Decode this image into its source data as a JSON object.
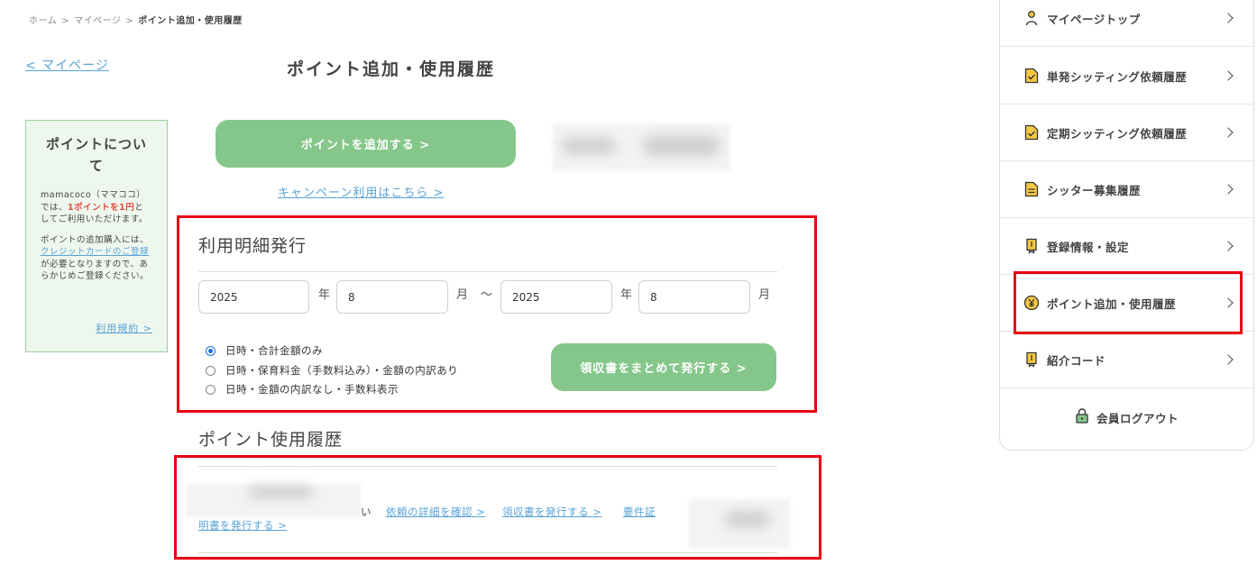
{
  "breadcrumb": {
    "home": "ホーム",
    "mypage": "マイページ",
    "current": "ポイント追加・使用履歴",
    "sep": ">"
  },
  "back_link": "< マイページ",
  "page_title": "ポイント追加・使用履歴",
  "info_box": {
    "title": "ポイントについて",
    "p1_a": "mamacoco（ママココ）では、",
    "p1_red": "1ポイントを1円",
    "p1_b": "としてご利用いただけます。",
    "p2_a": "ポイントの追加購入には、",
    "p2_link": "クレジットカードのご登録",
    "p2_b": "が必要となりますので、あらかじめご登録ください。",
    "terms": "利用規約 >"
  },
  "add_button": "ポイントを追加する >",
  "campaign_link": "キャンペーン利用はこちら >",
  "statement": {
    "title": "利用明細発行",
    "from_year": "2025",
    "from_month": "8",
    "to_year": "2025",
    "to_month": "8",
    "year_unit": "年",
    "month_unit": "月",
    "tilde": "〜",
    "options": [
      "日時・合計金額のみ",
      "日時・保育料金（手数料込み）・金額の内訳あり",
      "日時・金額の内訳なし・手数料表示"
    ],
    "selected_option": 0,
    "issue_button": "領収書をまとめて発行する >"
  },
  "history": {
    "title": "ポイント使用履歴",
    "trailing_char": "い",
    "detail_link": "依頼の詳細を確認 >",
    "receipt_link": "領収書を発行する >",
    "cert_link_a": "要件証",
    "cert_link_b": "明書を発行する >"
  },
  "sidebar": {
    "items": [
      {
        "label": "マイページトップ",
        "icon": "person-icon"
      },
      {
        "label": "単発シッティング依頼履歴",
        "icon": "document-check-icon"
      },
      {
        "label": "定期シッティング依頼履歴",
        "icon": "document-check-icon"
      },
      {
        "label": "シッター募集履歴",
        "icon": "document-lines-icon"
      },
      {
        "label": "登録情報・設定",
        "icon": "id-card-icon"
      },
      {
        "label": "ポイント追加・使用履歴",
        "icon": "yen-coin-icon"
      },
      {
        "label": "紹介コード",
        "icon": "id-card-icon"
      }
    ],
    "logout": "会員ログアウト"
  },
  "colors": {
    "accent_green": "#85c78a",
    "link_blue": "#5aa3d6",
    "highlight_red": "#e60012",
    "icon_yellow": "#f5c842"
  }
}
